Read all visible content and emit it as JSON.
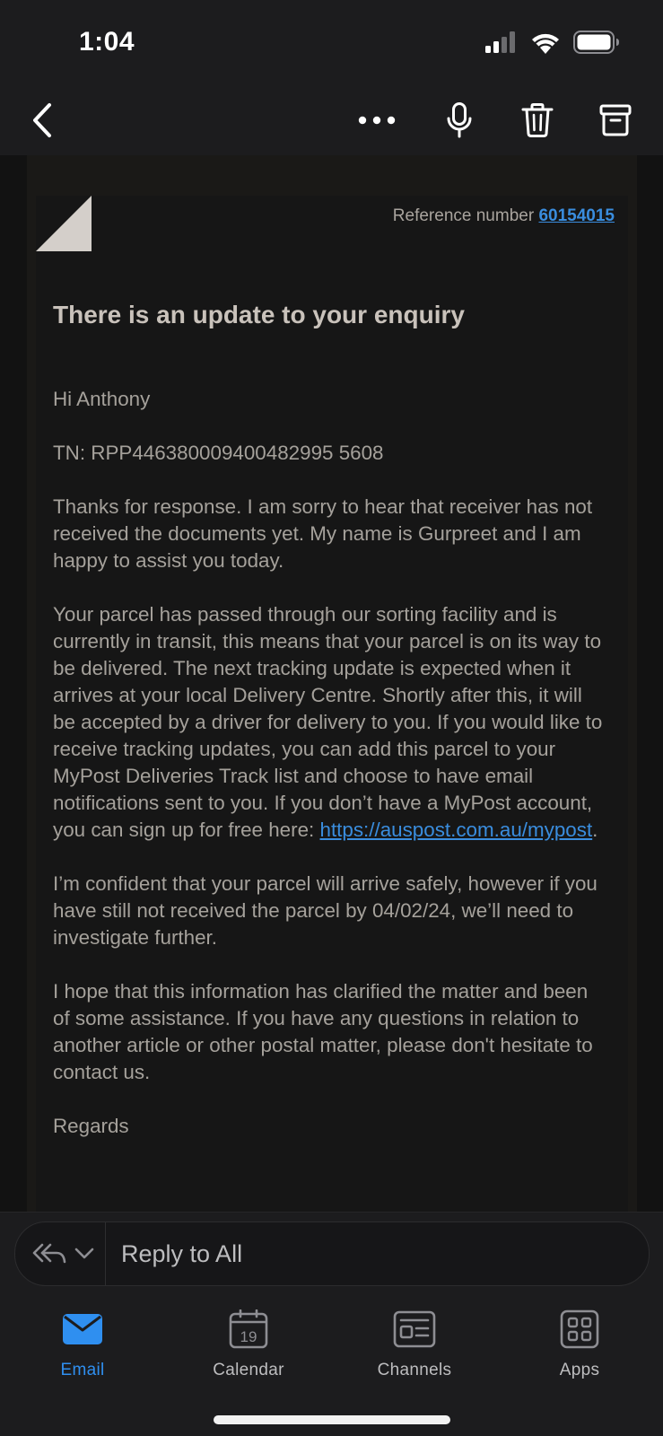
{
  "status_bar": {
    "time": "1:04"
  },
  "nav": {
    "back_icon": "chevron-left-icon",
    "icons": [
      "more-icon",
      "microphone-icon",
      "trash-icon",
      "archive-icon"
    ]
  },
  "email": {
    "reference_label": "Reference number",
    "reference_number": "60154015",
    "title": "There is an update to your enquiry",
    "greeting": "Hi Anthony",
    "tracking": "TN: RPP446380009400482995 5608",
    "para1": "Thanks for response. I am sorry to hear that receiver has not received the documents yet. My name is Gurpreet and I am happy to assist you today.",
    "para2_text": "Your parcel has passed through our sorting facility and is currently in transit, this means that your parcel is on its way to be delivered. The next tracking update is expected when it arrives at your local Delivery Centre. Shortly after this, it will be accepted by a driver for delivery to you. If you would like to receive tracking updates, you can add this parcel to your MyPost Deliveries Track list and choose to have email notifications sent to you. If you don’t have a MyPost account, you can sign up for free here:",
    "para2_link": "https://auspost.com.au/mypost",
    "para2_end": ".",
    "para3": "I’m confident that your parcel will arrive safely, however if you have still not received the parcel by 04/02/24, we’ll need to investigate further.",
    "para4": "I hope that this information has clarified the matter and been of some assistance. If you have any questions in relation to another article or other postal matter, please don't hesitate to contact us.",
    "signoff": "Regards"
  },
  "reply": {
    "label": "Reply to All"
  },
  "tabs": [
    {
      "label": "Email",
      "icon": "mail-icon",
      "active": true
    },
    {
      "label": "Calendar",
      "icon": "calendar-icon",
      "date": "19"
    },
    {
      "label": "Channels",
      "icon": "channels-icon"
    },
    {
      "label": "Apps",
      "icon": "apps-icon"
    }
  ],
  "colors": {
    "accent": "#2f8ff0",
    "link": "#3a8dde",
    "background": "#1c1c1e"
  }
}
